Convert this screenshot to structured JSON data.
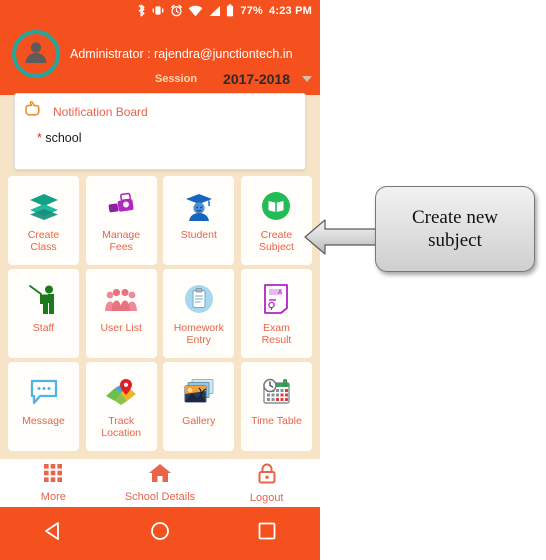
{
  "status_bar": {
    "icons": [
      "bluetooth-icon",
      "vibrate-icon",
      "alarm-icon",
      "wifi-icon",
      "signal-icon",
      "battery-icon"
    ],
    "battery_percent": "77%",
    "time": "4:23 PM"
  },
  "header": {
    "avatar_icon": "user-avatar-icon",
    "admin_text": "Administrator : rajendra@junctiontech.in",
    "session_label": "Session",
    "session_value": "2017-2018",
    "caret_icon": "chevron-down-icon",
    "bg_color": "#f4511e",
    "avatar_ring_color": "#26a69a"
  },
  "notification": {
    "icon": "pointing-hand-icon",
    "title": "Notification Board",
    "bullet": "*",
    "item": "school",
    "title_color": "#e8644a"
  },
  "grid": {
    "label_color": "#e8644a",
    "rows": [
      [
        {
          "label": "Create\nClass",
          "icon": "layers-icon",
          "color": "#14a085"
        },
        {
          "label": "Manage\nFees",
          "icon": "money-icon",
          "color": "#aa22aa"
        },
        {
          "label": "Student",
          "icon": "graduate-icon",
          "color": "#1565c0"
        },
        {
          "label": "Create\nSubject",
          "icon": "book-circle-icon",
          "color": "#23bb55"
        }
      ],
      [
        {
          "label": "Staff",
          "icon": "teacher-icon",
          "color": "#1b7a1b"
        },
        {
          "label": "User List",
          "icon": "people-group-icon",
          "color": "#e8737f"
        },
        {
          "label": "Homework\nEntry",
          "icon": "clipboard-icon",
          "color": "#64b5e8"
        },
        {
          "label": "Exam\nResult",
          "icon": "exam-paper-icon",
          "color": "#b024c4"
        }
      ],
      [
        {
          "label": "Message",
          "icon": "chat-bubble-icon",
          "color": "#4fb3e8"
        },
        {
          "label": "Track\nLocation",
          "icon": "map-pin-icon",
          "color": "#e02020"
        },
        {
          "label": "Gallery",
          "icon": "photo-icon",
          "color": "#e08030"
        },
        {
          "label": "Time Table",
          "icon": "calendar-clock-icon",
          "color": "#3aa35a"
        }
      ]
    ]
  },
  "bottom_bar": {
    "items": [
      {
        "label": "More",
        "icon": "grid-menu-icon"
      },
      {
        "label": "School Details",
        "icon": "home-icon"
      },
      {
        "label": "Logout",
        "icon": "lock-icon"
      }
    ],
    "color": "#e8644a"
  },
  "android_nav": {
    "back_icon": "triangle-back-icon",
    "home_icon": "circle-home-icon",
    "recents_icon": "square-recents-icon",
    "bg_color": "#f4511e"
  },
  "annotation": {
    "text": "Create new\nsubject",
    "arrow_icon": "left-arrow-icon"
  }
}
